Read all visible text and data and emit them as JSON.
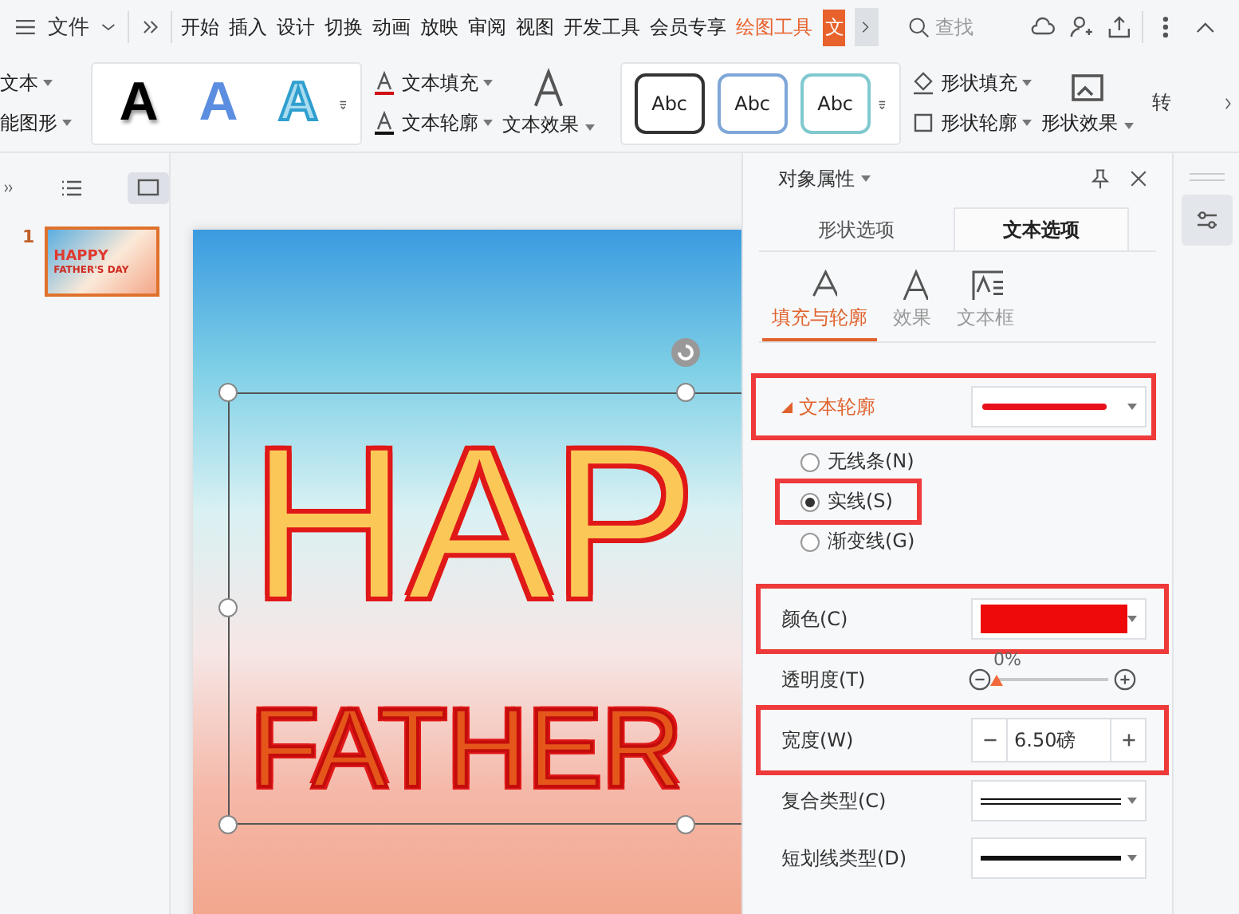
{
  "menubar": {
    "file": "文件",
    "tabs": [
      {
        "label": "开始",
        "selected": false
      },
      {
        "label": "插入",
        "selected": false
      },
      {
        "label": "设计",
        "selected": false
      },
      {
        "label": "切换",
        "selected": false
      },
      {
        "label": "动画",
        "selected": false
      },
      {
        "label": "放映",
        "selected": false
      },
      {
        "label": "审阅",
        "selected": false
      },
      {
        "label": "视图",
        "selected": false
      },
      {
        "label": "开发工具",
        "selected": false
      },
      {
        "label": "会员专享",
        "selected": false
      },
      {
        "label": "绘图工具",
        "selected": true
      }
    ],
    "cut_tab": "文",
    "search": {
      "placeholder": "查找"
    }
  },
  "ribbon": {
    "cut_left": [
      "文本",
      "能图形"
    ],
    "wordart_styles": [
      {
        "label": "A",
        "kind": "solid"
      },
      {
        "label": "A",
        "kind": "blue"
      },
      {
        "label": "A",
        "kind": "outline"
      }
    ],
    "text_buttons": [
      "文本填充",
      "文本轮廓"
    ],
    "text_effect": "文本效果",
    "shape_styles": [
      {
        "label": "Abc",
        "color": "#333333"
      },
      {
        "label": "Abc",
        "color": "#7ea6d8"
      },
      {
        "label": "Abc",
        "color": "#7fc9cf"
      }
    ],
    "shape_buttons": [
      "形状填充",
      "形状轮廓"
    ],
    "shape_effect": "形状效果",
    "cut_right": "转"
  },
  "slides": [
    {
      "number": "1",
      "selected": true,
      "line1": "HAPPY",
      "line2": "FATHER'S DAY"
    }
  ],
  "slide": {
    "line1": "HAP",
    "line2": "FATHER"
  },
  "panel": {
    "title": "对象属性",
    "tabs": [
      {
        "label": "形状选项",
        "selected": false
      },
      {
        "label": "文本选项",
        "selected": true
      }
    ],
    "subtabs": [
      {
        "label": "填充与轮廓",
        "kind": "fill",
        "selected": true
      },
      {
        "label": "效果",
        "kind": "effect",
        "selected": false
      },
      {
        "label": "文本框",
        "kind": "textbox",
        "selected": false
      }
    ],
    "section": {
      "label": "文本轮廓",
      "expanded": true,
      "highlighted": true
    },
    "radios": [
      {
        "label": "无线条(N)",
        "selected": false,
        "highlighted": false
      },
      {
        "label": "实线(S)",
        "selected": true,
        "highlighted": true
      },
      {
        "label": "渐变线(G)",
        "selected": false,
        "highlighted": false
      }
    ],
    "color": {
      "label": "颜色(C)",
      "color": "#ee0a0a",
      "highlighted": true
    },
    "transparency": {
      "label": "透明度(T)",
      "level": 0,
      "reading": "0%"
    },
    "width": {
      "label": "宽度(W)",
      "value": "6.50磅",
      "highlighted": true
    },
    "compound": {
      "label": "复合类型(C)"
    },
    "dash": {
      "label": "短划线类型(D)"
    }
  }
}
